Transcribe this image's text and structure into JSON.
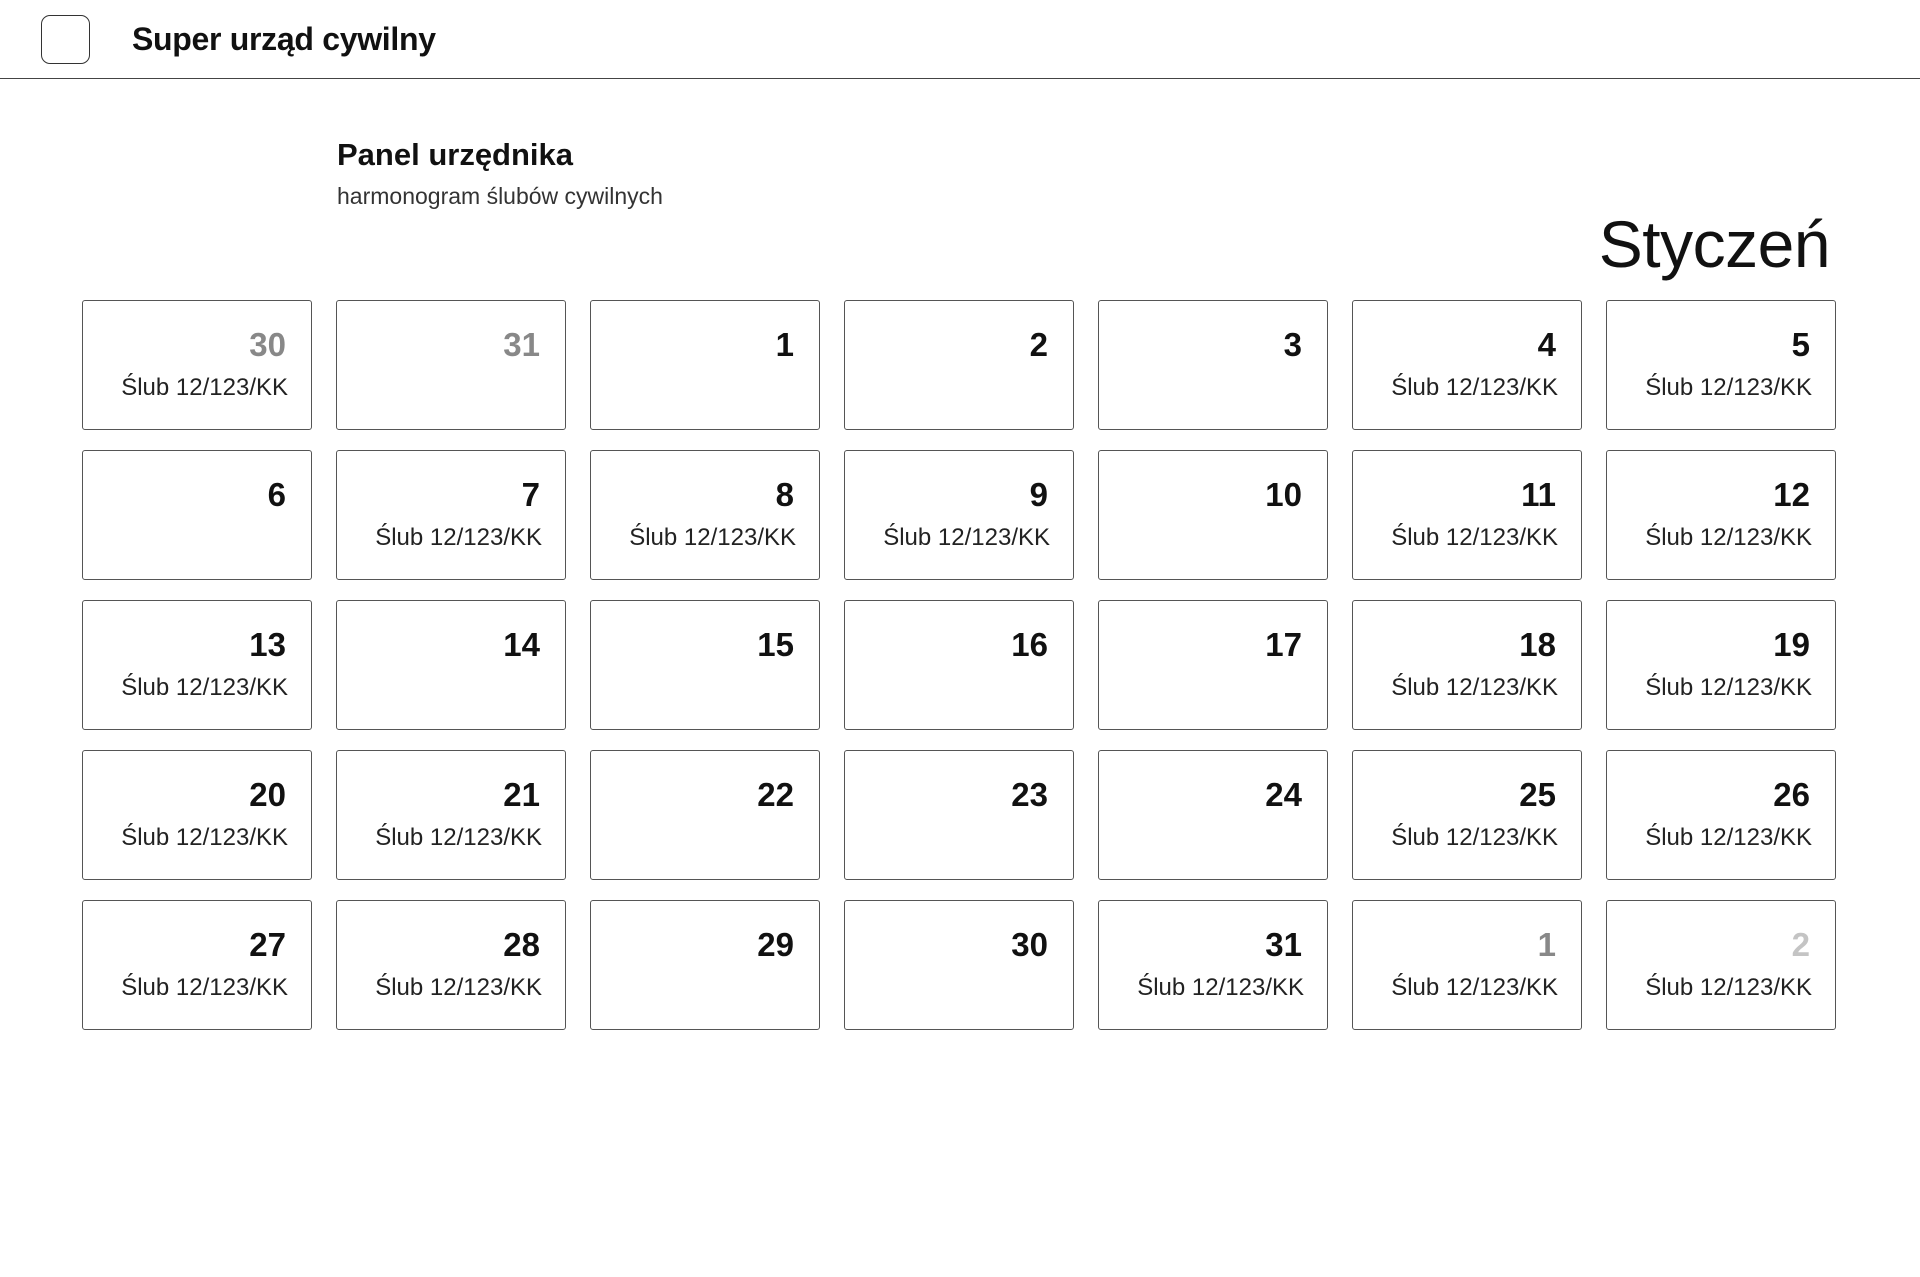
{
  "header": {
    "app_title": "Super urząd cywilny",
    "logo_icon": "app-logo-icon"
  },
  "page": {
    "title": "Panel urzędnika",
    "subtitle": "harmonogram ślubów cywilnych",
    "month": "Styczeń"
  },
  "calendar": {
    "days": [
      {
        "day": "30",
        "event": "Ślub 12/123/KK",
        "tone": "muted"
      },
      {
        "day": "31",
        "event": "",
        "tone": "muted"
      },
      {
        "day": "1",
        "event": "",
        "tone": "normal"
      },
      {
        "day": "2",
        "event": "",
        "tone": "normal"
      },
      {
        "day": "3",
        "event": "",
        "tone": "normal"
      },
      {
        "day": "4",
        "event": "Ślub 12/123/KK",
        "tone": "normal"
      },
      {
        "day": "5",
        "event": "Ślub 12/123/KK",
        "tone": "normal"
      },
      {
        "day": "6",
        "event": "",
        "tone": "normal"
      },
      {
        "day": "7",
        "event": "Ślub 12/123/KK",
        "tone": "normal"
      },
      {
        "day": "8",
        "event": "Ślub 12/123/KK",
        "tone": "normal"
      },
      {
        "day": "9",
        "event": "Ślub 12/123/KK",
        "tone": "normal"
      },
      {
        "day": "10",
        "event": "",
        "tone": "normal"
      },
      {
        "day": "11",
        "event": "Ślub 12/123/KK",
        "tone": "normal"
      },
      {
        "day": "12",
        "event": "Ślub 12/123/KK",
        "tone": "normal"
      },
      {
        "day": "13",
        "event": "Ślub 12/123/KK",
        "tone": "normal"
      },
      {
        "day": "14",
        "event": "",
        "tone": "normal"
      },
      {
        "day": "15",
        "event": "",
        "tone": "normal"
      },
      {
        "day": "16",
        "event": "",
        "tone": "normal"
      },
      {
        "day": "17",
        "event": "",
        "tone": "normal"
      },
      {
        "day": "18",
        "event": "Ślub 12/123/KK",
        "tone": "normal"
      },
      {
        "day": "19",
        "event": "Ślub 12/123/KK",
        "tone": "normal"
      },
      {
        "day": "20",
        "event": "Ślub 12/123/KK",
        "tone": "normal"
      },
      {
        "day": "21",
        "event": "Ślub 12/123/KK",
        "tone": "normal"
      },
      {
        "day": "22",
        "event": "",
        "tone": "normal"
      },
      {
        "day": "23",
        "event": "",
        "tone": "normal"
      },
      {
        "day": "24",
        "event": "",
        "tone": "normal"
      },
      {
        "day": "25",
        "event": "Ślub 12/123/KK",
        "tone": "normal"
      },
      {
        "day": "26",
        "event": "Ślub 12/123/KK",
        "tone": "normal"
      },
      {
        "day": "27",
        "event": "Ślub 12/123/KK",
        "tone": "normal"
      },
      {
        "day": "28",
        "event": "Ślub 12/123/KK",
        "tone": "normal"
      },
      {
        "day": "29",
        "event": "",
        "tone": "normal"
      },
      {
        "day": "30",
        "event": "",
        "tone": "normal"
      },
      {
        "day": "31",
        "event": "Ślub 12/123/KK",
        "tone": "normal"
      },
      {
        "day": "1",
        "event": "Ślub 12/123/KK",
        "tone": "muted"
      },
      {
        "day": "2",
        "event": "Ślub 12/123/KK",
        "tone": "faint"
      }
    ]
  }
}
